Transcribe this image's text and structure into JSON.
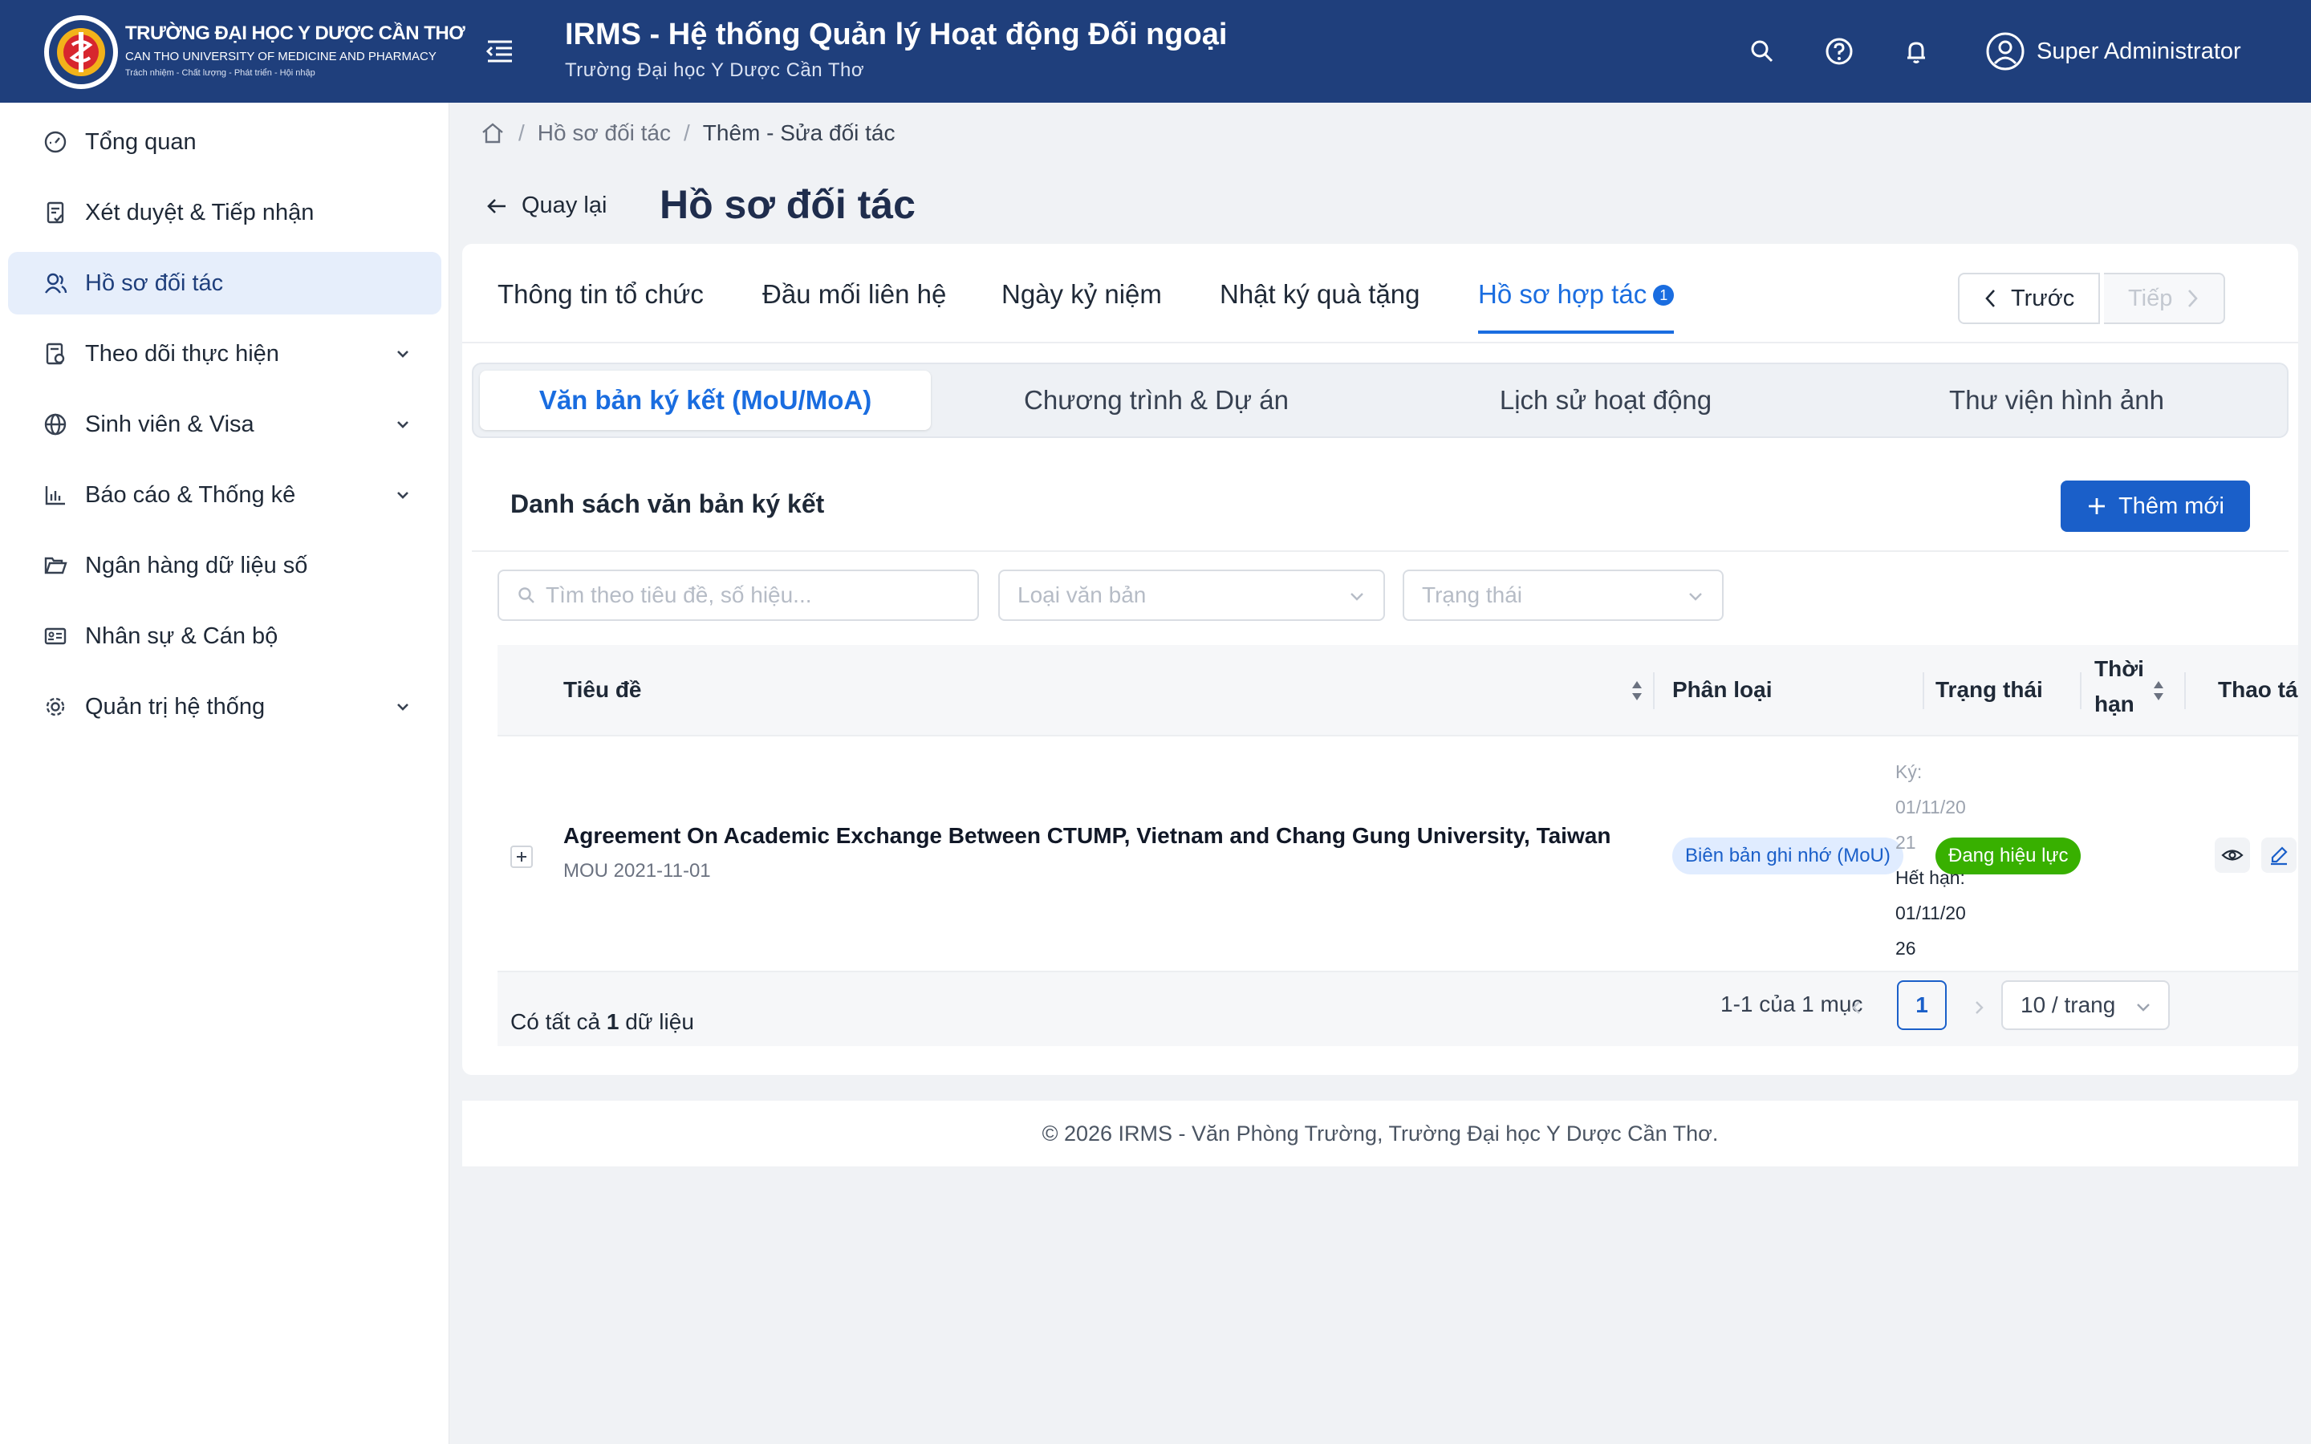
{
  "header": {
    "university_name": "TRƯỜNG ĐẠI HỌC Y DƯỢC CẦN THƠ",
    "university_name_en": "CAN THO UNIVERSITY OF MEDICINE AND PHARMACY",
    "university_motto": "Trách nhiệm - Chất lượng - Phát triển - Hội nhập",
    "app_title": "IRMS - Hệ thống Quản lý Hoạt động Đối ngoại",
    "app_subtitle": "Trường Đại học Y Dược Cần Thơ",
    "user_name": "Super Administrator",
    "colors": {
      "background": "#1f3f7c"
    },
    "icons": [
      "menu-fold-icon",
      "search-icon",
      "help-icon",
      "bell-icon",
      "user-icon"
    ]
  },
  "sidebar": {
    "items": [
      {
        "label": "Tổng quan",
        "icon": "dashboard-icon"
      },
      {
        "label": "Xét duyệt & Tiếp nhận",
        "icon": "document-check-icon"
      },
      {
        "label": "Hồ sơ đối tác",
        "icon": "partners-icon",
        "active": true
      },
      {
        "label": "Theo dõi thực hiện",
        "icon": "tracking-icon",
        "expandable": true
      },
      {
        "label": "Sinh viên & Visa",
        "icon": "globe-icon",
        "expandable": true
      },
      {
        "label": "Báo cáo & Thống kê",
        "icon": "bar-chart-icon",
        "expandable": true
      },
      {
        "label": "Ngân hàng dữ liệu số",
        "icon": "folder-icon"
      },
      {
        "label": "Nhân sự & Cán bộ",
        "icon": "id-card-icon"
      },
      {
        "label": "Quản trị hệ thống",
        "icon": "gear-icon",
        "expandable": true
      }
    ]
  },
  "breadcrumb": {
    "sep": "/",
    "items": [
      "Hồ sơ đối tác",
      "Thêm - Sửa đối tác"
    ]
  },
  "page": {
    "back_label": "Quay lại",
    "title": "Hồ sơ đối tác"
  },
  "tabs": {
    "items": [
      {
        "label": "Thông tin tổ chức"
      },
      {
        "label": "Đầu mối liên hệ"
      },
      {
        "label": "Ngày kỷ niệm"
      },
      {
        "label": "Nhật ký quà tặng"
      },
      {
        "label": "Hồ sơ hợp tác",
        "active": true,
        "badge": "1"
      }
    ],
    "prev_label": "Trước",
    "next_label": "Tiếp"
  },
  "subtabs": {
    "items": [
      {
        "label": "Văn bản ký kết (MoU/MoA)",
        "active": true
      },
      {
        "label": "Chương trình & Dự án"
      },
      {
        "label": "Lịch sử hoạt động"
      },
      {
        "label": "Thư viện hình ảnh"
      }
    ]
  },
  "list": {
    "title": "Danh sách văn bản ký kết",
    "add_label": "Thêm mới",
    "search_placeholder": "Tìm theo tiêu đề, số hiệu...",
    "type_placeholder": "Loại văn bản",
    "status_placeholder": "Trạng thái"
  },
  "table": {
    "columns": {
      "title": "Tiêu đề",
      "type": "Phân loại",
      "status": "Trạng thái",
      "term_1": "Thời",
      "term_2": "hạn",
      "actions": "Thao tác"
    },
    "rows": [
      {
        "title": "Agreement On Academic Exchange Between CTUMP, Vietnam and Chang Gung University, Taiwan",
        "code": "MOU 2021-11-01",
        "type": "Biên bản ghi nhớ (MoU)",
        "status": "Đang hiệu lực",
        "signed_label": "Ký:",
        "signed_date_1": "01/11/20",
        "signed_date_2": "21",
        "expiry_label": "Hết hạn:",
        "expiry_date_1": "01/11/20",
        "expiry_date_2": "26"
      }
    ],
    "footer": {
      "total_prefix": "Có tất cả",
      "total_count": "1",
      "total_suffix": "dữ liệu",
      "range": "1-1 của 1 mục",
      "page": "1",
      "page_size": "10 / trang"
    }
  },
  "footer": {
    "text": "© 2026 IRMS - Văn Phòng Trường, Trường Đại học Y Dược Cần Thơ."
  }
}
